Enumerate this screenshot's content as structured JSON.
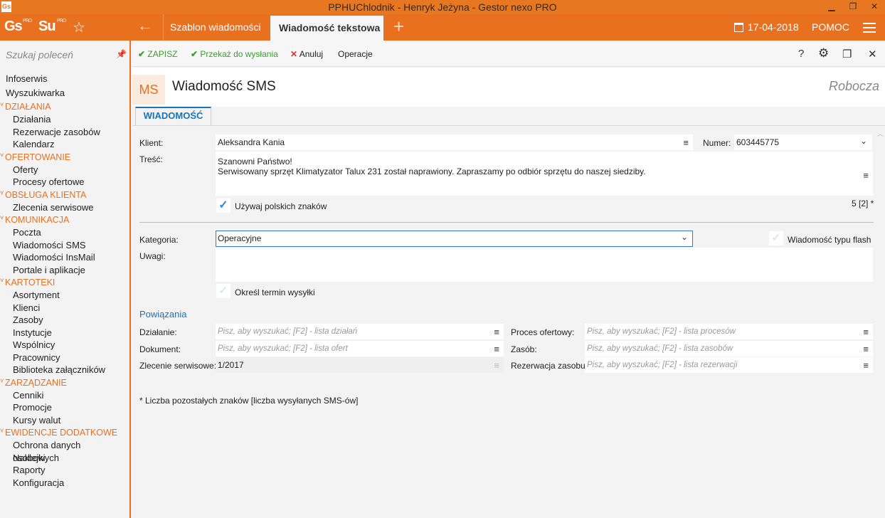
{
  "window": {
    "title": "PPHUChlodnik - Henryk Jeżyna - Gestor nexo PRO",
    "app_icon": "Gs",
    "controls": [
      "▁",
      "❐",
      "✕"
    ]
  },
  "header": {
    "logo_gs": "Gs",
    "logo_gs_sup": "PRO",
    "logo_su": "Su",
    "logo_su_sup": "PRO",
    "tabs": [
      {
        "label": "Szablon wiadomości",
        "active": false
      },
      {
        "label": "Wiadomość tekstowa",
        "active": true
      }
    ],
    "date": "17-04-2018",
    "help": "POMOC",
    "accent": "#e8701f"
  },
  "sidebar": {
    "search_placeholder": "Szukaj poleceń",
    "roots": [
      "Infoserwis",
      "Wyszukiwarka"
    ],
    "sections": [
      {
        "title": "DZIAŁANIA",
        "items": [
          "Działania",
          "Rezerwacje zasobów",
          "Kalendarz"
        ]
      },
      {
        "title": "OFERTOWANIE",
        "items": [
          "Oferty",
          "Procesy ofertowe"
        ]
      },
      {
        "title": "OBSŁUGA KLIENTA",
        "items": [
          "Zlecenia serwisowe"
        ]
      },
      {
        "title": "KOMUNIKACJA",
        "items": [
          "Poczta",
          "Wiadomości SMS",
          "Wiadomości InsMail",
          "Portale i aplikacje"
        ]
      },
      {
        "title": "KARTOTEKI",
        "items": [
          "Asortyment",
          "Klienci",
          "Zasoby",
          "Instytucje",
          "Wspólnicy",
          "Pracownicy",
          "Biblioteka załączników"
        ]
      },
      {
        "title": "ZARZĄDZANIE",
        "items": [
          "Cenniki",
          "Promocje",
          "Kursy walut"
        ]
      },
      {
        "title": "EWIDENCJE DODATKOWE",
        "items": [
          "Ochrona danych osobowych",
          "Naklejki",
          "Raporty",
          "Konfiguracja"
        ]
      }
    ]
  },
  "toolbar": {
    "save": "ZAPISZ",
    "send": "Przekaż do wysłania",
    "cancel": "Anuluj",
    "operations": "Operacje",
    "help": "?",
    "settings": "⚙",
    "restore": "❐",
    "close": "✕"
  },
  "document": {
    "badge": "MS",
    "title": "Wiadomość SMS",
    "status": "Robocza",
    "subtab": "WIADOMOŚĆ"
  },
  "form": {
    "client_label": "Klient:",
    "client_value": "Aleksandra Kania",
    "number_label": "Numer:",
    "number_value": "603445775",
    "content_label": "Treść:",
    "content_line1": "Szanowni Państwo!",
    "content_line2": "Serwisowany sprzęt Klimatyzator Talux 231 został naprawiony. Zapraszamy po odbiór sprzętu do naszej siedziby.",
    "polish_chars_label": "Używaj polskich znaków",
    "polish_chars_checked": true,
    "chars_counter": "5 [2] *",
    "category_label": "Kategoria:",
    "category_value": "Operacyjne",
    "flash_label": "Wiadomość typu flash",
    "flash_checked": false,
    "notes_label": "Uwagi:",
    "send_date_label": "Określ termin wysyłki",
    "send_date_checked": false
  },
  "links": {
    "title": "Powiązania",
    "action_label": "Działanie:",
    "action_placeholder": "Pisz, aby wyszukać; [F2] - lista działań",
    "document_label": "Dokument:",
    "document_placeholder": "Pisz, aby wyszukać; [F2] - lista ofert",
    "service_label": "Zlecenie serwisowe:",
    "service_value": "1/2017",
    "offer_process_label": "Proces ofertowy:",
    "offer_process_placeholder": "Pisz, aby wyszukać; [F2] - lista procesów",
    "resource_label": "Zasób:",
    "resource_placeholder": "Pisz, aby wyszukać; [F2] - lista zasobów",
    "reservation_label": "Rezerwacja zasobu:",
    "reservation_placeholder": "Pisz, aby wyszukać; [F2] - lista rezerwacji"
  },
  "footnote": "* Liczba pozostałych znaków [liczba wysyłanych SMS-ów]"
}
